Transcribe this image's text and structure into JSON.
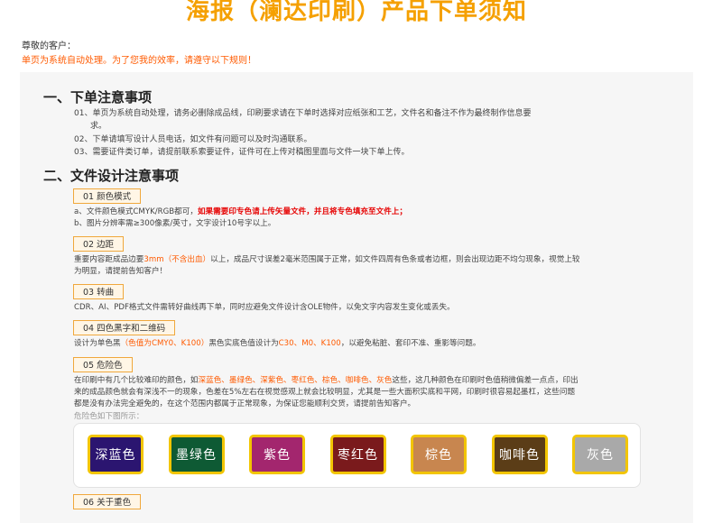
{
  "header": {
    "title": "海报（澜达印刷）产品下单须知",
    "greeting": "尊敬的客户：",
    "notice": "单页为系统自动处理。为了您我的效率，请遵守以下规则！"
  },
  "section1": {
    "title": "一、下单注意事项",
    "line1a": "01、单页为系统自动处理，请务必删除成品线，印刷要求请在下单时选择对应纸张和工艺，文件名和备注不作为最终制作信息要",
    "line1b": "求。",
    "line2": "02、下单请填写设计人员电话，如文件有问题可以及时沟通联系。",
    "line3": "03、需要证件类订单，请提前联系索要证件，证件可在上传对稿图里面与文件一块下单上传。"
  },
  "section2": {
    "title": "二、文件设计注意事项",
    "items": [
      {
        "tag": "01  颜色模式",
        "a_pre": "a、文件颜色模式CMYK/RGB都可，",
        "a_red": "如果需要印专色请上传矢量文件，并且将专色填充至文件上；",
        "b": "b、图片分辨率需≥300像素/英寸，文字设计10号字以上。"
      },
      {
        "tag": "02  边距",
        "l1_pre": "重要内容距成品边要",
        "l1_or": "3mm（不含出血）",
        "l1_post": "以上，成品尺寸误差2毫米范围属于正常，如文件四周有色条或者边框，则会出现边距不均匀现象，视觉上较",
        "l2": "为明显，请提前告知客户！"
      },
      {
        "tag": "03  转曲",
        "l1": "CDR、AI、PDF格式文件需转好曲线再下单，同时应避免文件设计含OLE物件，以免文字内容发生变化或丢失。"
      },
      {
        "tag": "04  四色黑字和二维码",
        "l1_pre": "设计为单色黑",
        "l1_or1": "（色值为CMY0、K100）",
        "l1_mid": "黑色实底色值设计为",
        "l1_or2": "C30、M0、K100",
        "l1_post": "，以避免粘脏、套印不准、重影等问题。"
      },
      {
        "tag": "05  危险色",
        "l1_pre": "在印刷中有几个比较难印的颜色，如",
        "l1_or": "深蓝色、墨绿色、深紫色、枣红色、棕色、咖啡色、灰色",
        "l1_post": "这些，这几种颜色在印刷时色值稍微偏差一点点，印出",
        "l2": "来的成品颜色就会有深浅不一的现象，色差在5%左右在视觉感观上就会比较明显，尤其是一些大面积实底和平网，印刷时很容易起墨杠，这些问题",
        "l3": "都是没有办法完全避免的，在这个范围内都属于正常现象，为保证您能顺利交货，请提前告知客户。",
        "caption": "危险色如下图所示："
      },
      {
        "tag": "06  关于重色"
      }
    ]
  },
  "swatches": [
    {
      "label": "深蓝色",
      "color": "#2b1570"
    },
    {
      "label": "墨绿色",
      "color": "#0e5a34"
    },
    {
      "label": "紫色",
      "color": "#a3266e"
    },
    {
      "label": "枣红色",
      "color": "#7a1a1c"
    },
    {
      "label": "棕色",
      "color": "#c8864f"
    },
    {
      "label": "咖啡色",
      "color": "#5b3d17"
    },
    {
      "label": "灰色",
      "color": "#a9a9a9"
    }
  ]
}
